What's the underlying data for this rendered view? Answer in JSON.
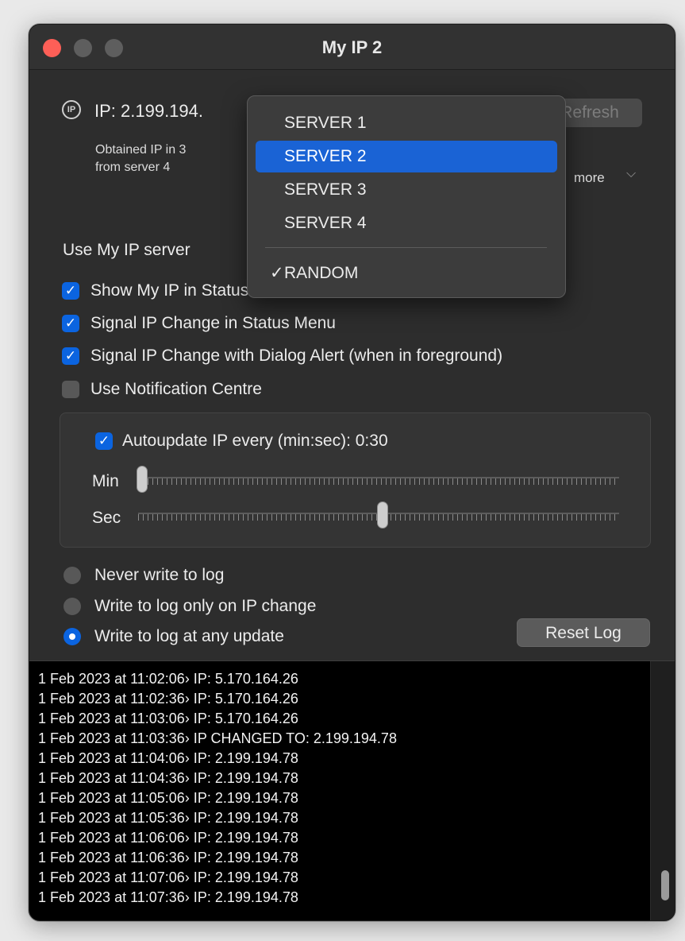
{
  "window": {
    "title": "My IP 2"
  },
  "ip": {
    "icon": "ip-badge-icon",
    "icon_text": "IP",
    "label": "IP: 2.199.194.",
    "obtained_line1": "Obtained IP in 3",
    "obtained_line2": "from server 4",
    "refresh_label": "Refresh",
    "more_label": "more",
    "more_chevron": "⌵"
  },
  "server": {
    "label": "Use My IP server"
  },
  "menu": {
    "items": [
      "SERVER 1",
      "SERVER 2",
      "SERVER 3",
      "SERVER 4"
    ],
    "highlighted": "SERVER 2",
    "random_label": "RANDOM",
    "checked": "RANDOM",
    "check_glyph": "✓"
  },
  "options": [
    {
      "label": "Show My IP in Status Menu",
      "checked": true
    },
    {
      "label": "Signal IP Change in Status Menu",
      "checked": true
    },
    {
      "label": "Signal IP Change with Dialog Alert (when in foreground)",
      "checked": true
    },
    {
      "label": "Use Notification Centre",
      "checked": false
    }
  ],
  "autoupdate": {
    "label": "Autoupdate IP every (min:sec): 0:30",
    "checked": true,
    "min_label": "Min",
    "sec_label": "Sec",
    "min_value": 0,
    "sec_value": 30
  },
  "log_mode": {
    "options": [
      "Never write to log",
      "Write to log only on IP change",
      "Write to log at any update"
    ],
    "selected": "Write to log at any update"
  },
  "reset_label": "Reset Log",
  "log": [
    "1 Feb 2023 at 11:02:06› IP: 5.170.164.26",
    "1 Feb 2023 at 11:02:36› IP: 5.170.164.26",
    "1 Feb 2023 at 11:03:06› IP: 5.170.164.26",
    "1 Feb 2023 at 11:03:36› IP CHANGED TO: 2.199.194.78",
    "1 Feb 2023 at 11:04:06› IP: 2.199.194.78",
    "1 Feb 2023 at 11:04:36› IP: 2.199.194.78",
    "1 Feb 2023 at 11:05:06› IP: 2.199.194.78",
    "1 Feb 2023 at 11:05:36› IP: 2.199.194.78",
    "1 Feb 2023 at 11:06:06› IP: 2.199.194.78",
    "1 Feb 2023 at 11:06:36› IP: 2.199.194.78",
    "1 Feb 2023 at 11:07:06› IP: 2.199.194.78",
    "1 Feb 2023 at 11:07:36› IP: 2.199.194.78"
  ],
  "colors": {
    "accent": "#0b64e0",
    "close": "#fe5f57",
    "window_bg": "#2d2d2d",
    "log_bg": "#000000"
  }
}
